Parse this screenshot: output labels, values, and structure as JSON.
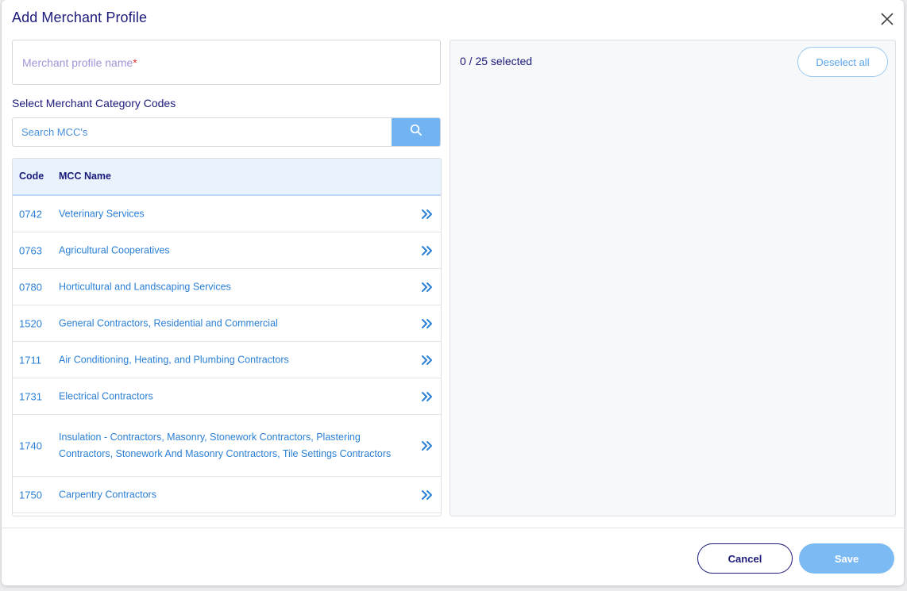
{
  "dialog": {
    "title": "Add Merchant Profile",
    "close_icon": "close-icon"
  },
  "form": {
    "profile_name_placeholder": "Merchant profile name",
    "required_marker": "*",
    "mcc_section_label": "Select Merchant Category Codes",
    "search_placeholder": "Search MCC's",
    "search_icon": "search-icon"
  },
  "table": {
    "columns": [
      "Code",
      "MCC Name"
    ],
    "row_action_icon": "double-chevron-right-icon",
    "rows": [
      {
        "code": "0742",
        "name": "Veterinary Services"
      },
      {
        "code": "0763",
        "name": "Agricultural Cooperatives"
      },
      {
        "code": "0780",
        "name": "Horticultural and Landscaping Services"
      },
      {
        "code": "1520",
        "name": "General Contractors, Residential and Commercial"
      },
      {
        "code": "1711",
        "name": "Air Conditioning, Heating, and Plumbing Contractors"
      },
      {
        "code": "1731",
        "name": "Electrical Contractors"
      },
      {
        "code": "1740",
        "name": "Insulation - Contractors, Masonry, Stonework Contractors, Plastering Contractors, Stonework And Masonry Contractors, Tile Settings Contractors"
      },
      {
        "code": "1750",
        "name": "Carpentry Contractors"
      }
    ]
  },
  "selection": {
    "count_text": "0 / 25 selected",
    "deselect_all_label": "Deselect all"
  },
  "footer": {
    "cancel_label": "Cancel",
    "save_label": "Save"
  },
  "colors": {
    "primary_text": "#1c1a7a",
    "link_blue": "#2a7fd4",
    "accent_blue": "#72b4f2",
    "required_red": "#e0302b"
  }
}
